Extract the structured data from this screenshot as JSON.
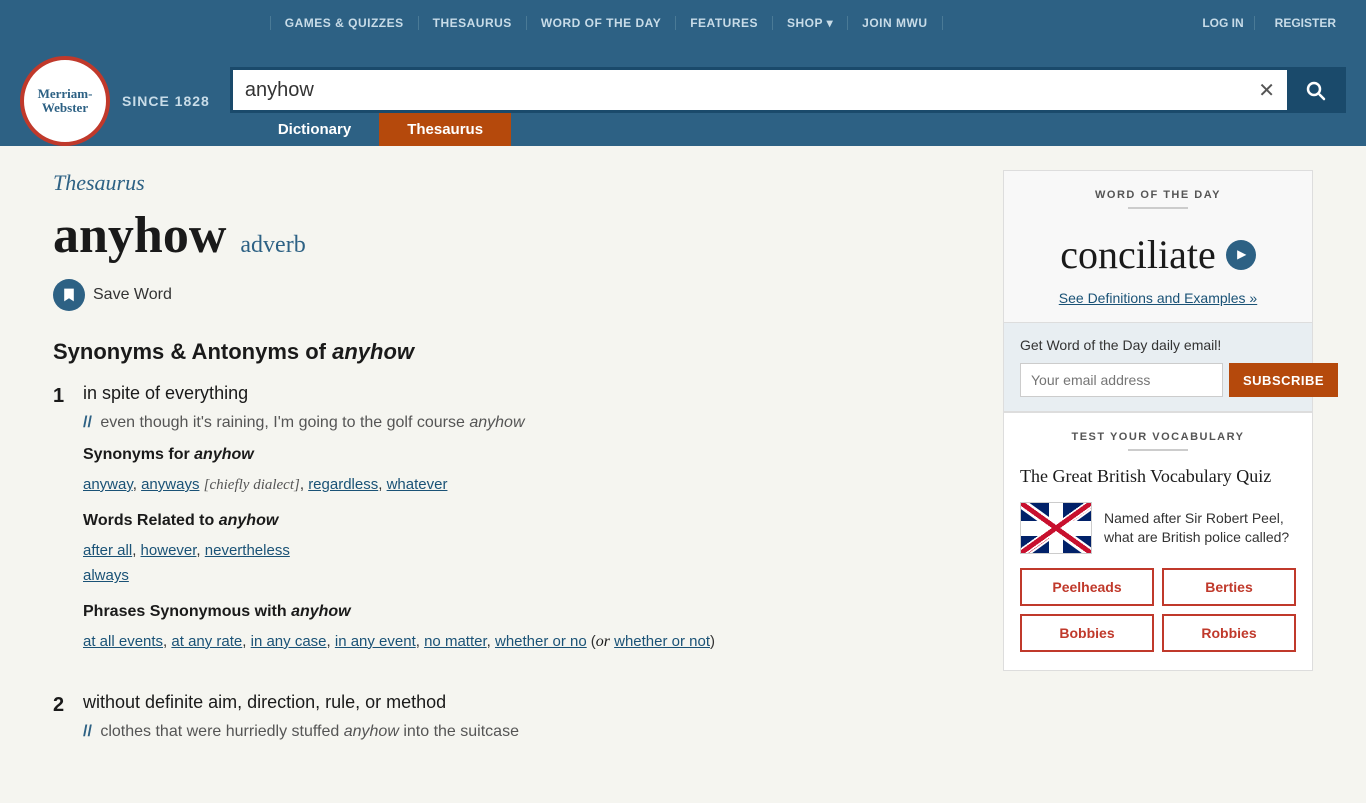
{
  "nav": {
    "links": [
      {
        "label": "GAMES & QUIZZES",
        "id": "games-quizzes"
      },
      {
        "label": "THESAURUS",
        "id": "thesaurus-nav"
      },
      {
        "label": "WORD OF THE DAY",
        "id": "word-of-the-day-nav"
      },
      {
        "label": "FEATURES",
        "id": "features-nav"
      },
      {
        "label": "SHOP ▾",
        "id": "shop-nav"
      },
      {
        "label": "JOIN MWU",
        "id": "join-mwu-nav"
      }
    ],
    "auth": [
      {
        "label": "LOG IN",
        "id": "login"
      },
      {
        "label": "REGISTER",
        "id": "register"
      }
    ]
  },
  "header": {
    "logo_line1": "Merriam-",
    "logo_line2": "Webster",
    "since": "SINCE 1828",
    "search_value": "anyhow",
    "search_placeholder": "Search"
  },
  "tabs": {
    "dictionary_label": "Dictionary",
    "thesaurus_label": "Thesaurus"
  },
  "main": {
    "page_type": "Thesaurus",
    "word": "anyhow",
    "pos": "adverb",
    "save_word": "Save Word",
    "synonyms_heading_prefix": "Synonyms & Antonyms of ",
    "synonyms_heading_word": "anyhow",
    "senses": [
      {
        "number": "1",
        "definition": "in spite of everything",
        "example": "even though it’s raining, I’m going to the golf course anyhow",
        "example_italic_word": "anyhow",
        "synonyms_title_prefix": "Synonyms for ",
        "synonyms_title_word": "anyhow",
        "synonyms": [
          {
            "word": "anyway",
            "comma": true
          },
          {
            "word": "anyways",
            "comma": false
          },
          {
            "bracket_note": "[chiefly dialect]",
            "comma": true
          },
          {
            "word": "regardless",
            "comma": true
          },
          {
            "word": "whatever",
            "comma": false
          }
        ],
        "synonyms_plain": "anyway, anyways [chiefly dialect], regardless, whatever",
        "related_title_prefix": "Words Related to ",
        "related_title_word": "anyhow",
        "related_words_line1": "after all, however, nevertheless",
        "related_words_line2": "always",
        "phrases_title_prefix": "Phrases Synonymous with ",
        "phrases_title_word": "anyhow",
        "phrases": "at all events, at any rate, in any case, in any event, no matter, whether or no (or whether or not)"
      },
      {
        "number": "2",
        "definition": "without definite aim, direction, rule, or method",
        "example": "clothes that were hurriedly stuffed anyhow into the suitcase",
        "example_italic_word": "anyhow"
      }
    ]
  },
  "sidebar": {
    "wotd": {
      "label": "WORD OF THE DAY",
      "word": "conciliate",
      "link_text": "See Definitions and Examples",
      "link_suffix": " »",
      "email_label": "Get Word of the Day daily email!",
      "email_placeholder": "Your email address",
      "subscribe_label": "SUBSCRIBE"
    },
    "vocab": {
      "label": "TEST YOUR VOCABULARY",
      "quiz_title": "The Great British Vocabulary Quiz",
      "quiz_question": "Named after Sir Robert Peel, what are British police called?",
      "answers": [
        "Peelheads",
        "Berties",
        "Bobbies",
        "Robbies"
      ]
    }
  }
}
